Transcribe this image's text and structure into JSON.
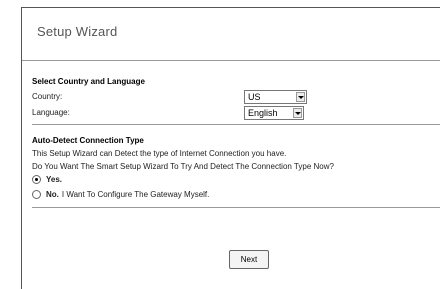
{
  "wizard": {
    "title": "Setup Wizard"
  },
  "country_language": {
    "heading": "Select Country and Language",
    "country_label": "Country:",
    "country_value": "US",
    "language_label": "Language:",
    "language_value": "English"
  },
  "auto_detect": {
    "heading": "Auto-Detect Connection Type",
    "line1": "This Setup Wizard can Detect the type of Internet Connection you have.",
    "line2": "Do You Want The Smart Setup Wizard To Try And Detect The Connection Type Now?",
    "option_yes_bold": "Yes.",
    "option_no_bold": "No.",
    "option_no_text": "I Want To Configure The Gateway Myself.",
    "selected": "yes"
  },
  "buttons": {
    "next": "Next"
  }
}
